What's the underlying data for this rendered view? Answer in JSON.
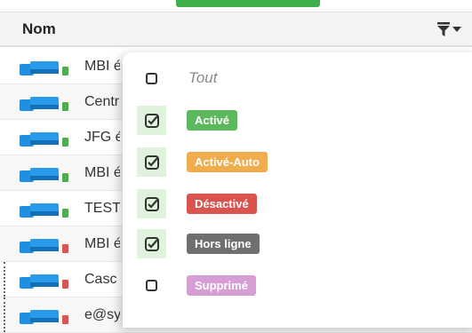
{
  "header": {
    "column_title": "Nom",
    "filter_icon": "filter-icon",
    "caret_icon": "chevron-down-icon"
  },
  "colors": {
    "online": "#4cae4c",
    "offline": "#d9534f",
    "device": "#1f8fe0"
  },
  "rows": [
    {
      "name": "MBI é",
      "status": "online"
    },
    {
      "name": "Centr",
      "status": "online"
    },
    {
      "name": "JFG é",
      "status": "online"
    },
    {
      "name": "MBI é",
      "status": "online"
    },
    {
      "name": "TEST",
      "status": "online"
    },
    {
      "name": "MBI é",
      "status": "offline"
    },
    {
      "name": "Casc",
      "status": "offline"
    },
    {
      "name": "e@sy",
      "status": "offline"
    }
  ],
  "filter_dropdown": {
    "all_label": "Tout",
    "all_checked": false,
    "options": [
      {
        "label": "Activé",
        "checked": true,
        "color": "#5cb85c"
      },
      {
        "label": "Activé-Auto",
        "checked": true,
        "color": "#f0ad4e"
      },
      {
        "label": "Désactivé",
        "checked": true,
        "color": "#d9534f"
      },
      {
        "label": "Hors ligne",
        "checked": true,
        "color": "#6f6f6f"
      },
      {
        "label": "Supprimé",
        "checked": false,
        "color": "#d79ed6"
      }
    ]
  }
}
